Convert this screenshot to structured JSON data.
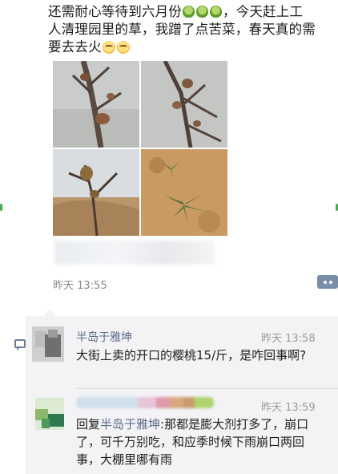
{
  "post": {
    "text_line1_prefix": "还需耐心等待到六月份",
    "text_line1_suffix": "，今天赶上工",
    "text_line2": "人清理园里的草，我蹭了点苦菜，春天真的需",
    "text_line3": "要去去火",
    "emoji_1": "cabbage-emoji",
    "emoji_2": "smile-emoji",
    "time": "昨天 13:55"
  },
  "comments": [
    {
      "name": "半岛于雅坤",
      "time": "昨天 13:58",
      "text": "大街上卖的开口的樱桃15/斤，是咋回事啊?"
    },
    {
      "time": "昨天 13:59",
      "reply_prefix": "回复",
      "reply_to": "半岛于雅坤",
      "text": ":那都是膨大剂打多了，崩口了，可千万别吃，和应季时候下雨崩口两回事，大棚里哪有雨"
    }
  ],
  "colors": {
    "link": "#5b6b8c",
    "comment_bg": "#f3f3f5",
    "more_button": "#7a8da6"
  }
}
